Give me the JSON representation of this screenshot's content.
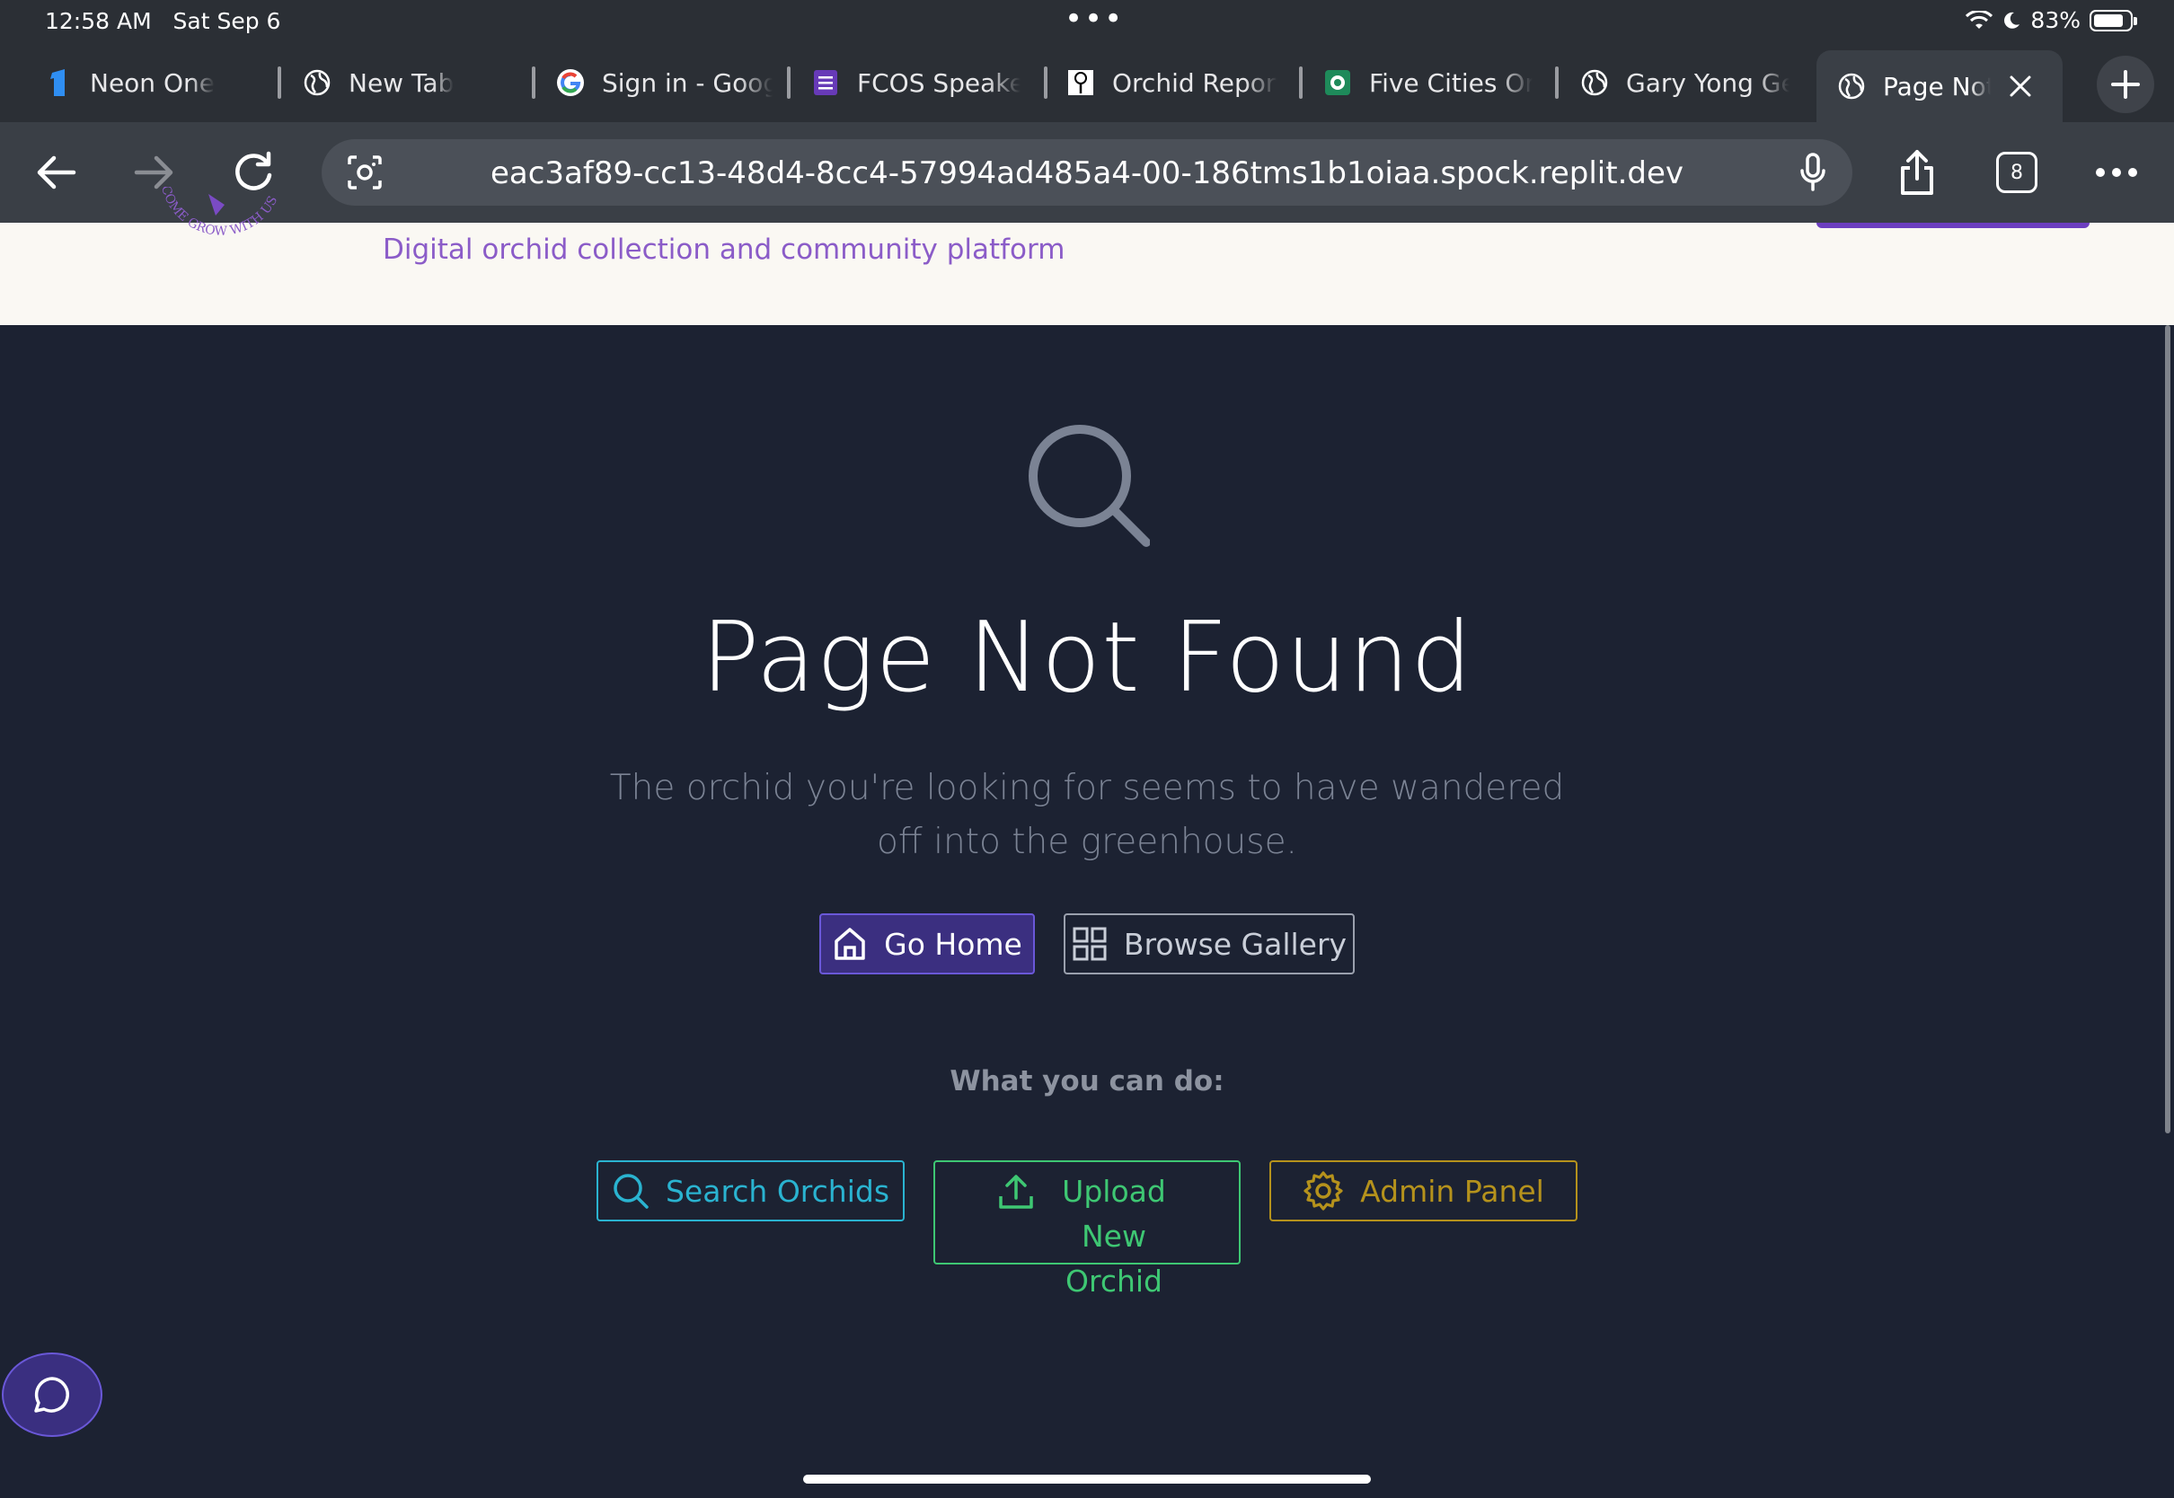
{
  "status_bar": {
    "time": "12:58 AM",
    "date": "Sat Sep 6",
    "battery": "83%"
  },
  "tabs": [
    {
      "label": "Neon One",
      "icon": "neon-one-icon"
    },
    {
      "label": "New Tab",
      "icon": "globe-icon"
    },
    {
      "label": "Sign in - Goog",
      "icon": "google-icon"
    },
    {
      "label": "FCOS Speake",
      "icon": "form-icon"
    },
    {
      "label": "Orchid Report",
      "icon": "orchid-icon"
    },
    {
      "label": "Five Cities Or",
      "icon": "five-cities-icon"
    },
    {
      "label": "Gary Yong Ge",
      "icon": "globe-icon"
    },
    {
      "label": "Page Not",
      "icon": "globe-icon"
    }
  ],
  "toolbar": {
    "url": "eac3af89-cc13-48d4-8cc4-57994ad485a4-00-186tms1b1oiaa.spock.replit.dev",
    "tab_count": "8"
  },
  "header": {
    "tagline": "Digital orchid collection and community platform",
    "logo_text": "COME GROW WITH US"
  },
  "page": {
    "title": "Page Not Found",
    "subtitle": "The orchid you're looking for seems to have wandered off into the greenhouse.",
    "go_home": "Go Home",
    "browse_gallery": "Browse Gallery",
    "what_you_can_do": "What you can do:",
    "search_orchids": "Search Orchids",
    "upload_new_orchid": "Upload New Orchid",
    "admin_panel": "Admin Panel"
  },
  "colors": {
    "page_bg": "#1c2232",
    "home_btn": "#3b2f80",
    "search": "#2ab3d0",
    "upload": "#3ec773",
    "admin": "#b5921c",
    "tagline": "#8b5cc8"
  }
}
